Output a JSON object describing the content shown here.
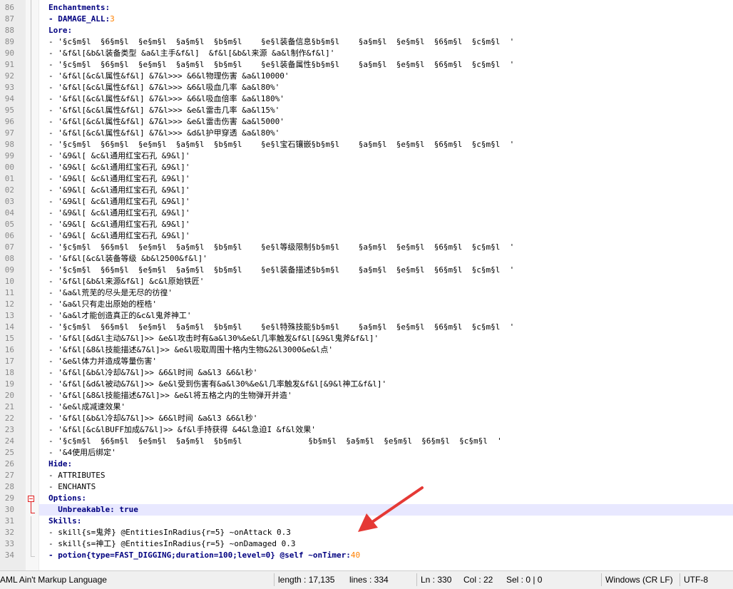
{
  "editor": {
    "lines": [
      {
        "n": "86",
        "segs": [
          [
            "k",
            "Enchantments:"
          ]
        ]
      },
      {
        "n": "87",
        "segs": [
          [
            "k",
            "- DAMAGE_ALL:"
          ],
          [
            "num",
            "3"
          ]
        ]
      },
      {
        "n": "88",
        "segs": [
          [
            "k",
            "Lore:"
          ]
        ]
      },
      {
        "n": "89",
        "segs": [
          [
            "t",
            "- '§c§m§l  §6§m§l  §e§m§l  §a§m§l  §b§m§l    §e§l装备信息§b§m§l    §a§m§l  §e§m§l  §6§m§l  §c§m§l  '"
          ]
        ]
      },
      {
        "n": "90",
        "segs": [
          [
            "t",
            "- '&f&l[&b&l装备类型 &a&l主手&f&l]  &f&l[&b&l来源 &a&l制作&f&l]'"
          ]
        ]
      },
      {
        "n": "91",
        "segs": [
          [
            "t",
            "- '§c§m§l  §6§m§l  §e§m§l  §a§m§l  §b§m§l    §e§l装备属性§b§m§l    §a§m§l  §e§m§l  §6§m§l  §c§m§l  '"
          ]
        ]
      },
      {
        "n": "92",
        "segs": [
          [
            "t",
            "- '&f&l[&c&l属性&f&l] &7&l>>> &6&l物理伤害 &a&l10000'"
          ]
        ]
      },
      {
        "n": "93",
        "segs": [
          [
            "t",
            "- '&f&l[&c&l属性&f&l] &7&l>>> &6&l吸血几率 &a&l80%'"
          ]
        ]
      },
      {
        "n": "94",
        "segs": [
          [
            "t",
            "- '&f&l[&c&l属性&f&l] &7&l>>> &6&l吸血倍率 &a&l180%'"
          ]
        ]
      },
      {
        "n": "95",
        "segs": [
          [
            "t",
            "- '&f&l[&c&l属性&f&l] &7&l>>> &e&l雷击几率 &a&l15%'"
          ]
        ]
      },
      {
        "n": "96",
        "segs": [
          [
            "t",
            "- '&f&l[&c&l属性&f&l] &7&l>>> &e&l雷击伤害 &a&l5000'"
          ]
        ]
      },
      {
        "n": "97",
        "segs": [
          [
            "t",
            "- '&f&l[&c&l属性&f&l] &7&l>>> &d&l护甲穿透 &a&l80%'"
          ]
        ]
      },
      {
        "n": "98",
        "segs": [
          [
            "t",
            "- '§c§m§l  §6§m§l  §e§m§l  §a§m§l  §b§m§l    §e§l宝石镶嵌§b§m§l    §a§m§l  §e§m§l  §6§m§l  §c§m§l  '"
          ]
        ]
      },
      {
        "n": "99",
        "segs": [
          [
            "t",
            "- '&9&l[ &c&l通用红宝石孔 &9&l]'"
          ]
        ]
      },
      {
        "n": "00",
        "segs": [
          [
            "t",
            "- '&9&l[ &c&l通用红宝石孔 &9&l]'"
          ]
        ]
      },
      {
        "n": "01",
        "segs": [
          [
            "t",
            "- '&9&l[ &c&l通用红宝石孔 &9&l]'"
          ]
        ]
      },
      {
        "n": "02",
        "segs": [
          [
            "t",
            "- '&9&l[ &c&l通用红宝石孔 &9&l]'"
          ]
        ]
      },
      {
        "n": "03",
        "segs": [
          [
            "t",
            "- '&9&l[ &c&l通用红宝石孔 &9&l]'"
          ]
        ]
      },
      {
        "n": "04",
        "segs": [
          [
            "t",
            "- '&9&l[ &c&l通用红宝石孔 &9&l]'"
          ]
        ]
      },
      {
        "n": "05",
        "segs": [
          [
            "t",
            "- '&9&l[ &c&l通用红宝石孔 &9&l]'"
          ]
        ]
      },
      {
        "n": "06",
        "segs": [
          [
            "t",
            "- '&9&l[ &c&l通用红宝石孔 &9&l]'"
          ]
        ]
      },
      {
        "n": "07",
        "segs": [
          [
            "t",
            "- '§c§m§l  §6§m§l  §e§m§l  §a§m§l  §b§m§l    §e§l等级限制§b§m§l    §a§m§l  §e§m§l  §6§m§l  §c§m§l  '"
          ]
        ]
      },
      {
        "n": "08",
        "segs": [
          [
            "t",
            "- '&f&l[&c&l装备等级 &b&l2500&f&l]'"
          ]
        ]
      },
      {
        "n": "09",
        "segs": [
          [
            "t",
            "- '§c§m§l  §6§m§l  §e§m§l  §a§m§l  §b§m§l    §e§l装备描述§b§m§l    §a§m§l  §e§m§l  §6§m§l  §c§m§l  '"
          ]
        ]
      },
      {
        "n": "10",
        "segs": [
          [
            "t",
            "- '&f&l[&b&l来源&f&l] &c&l原始铁匠'"
          ]
        ]
      },
      {
        "n": "11",
        "segs": [
          [
            "t",
            "- '&a&l荒芜的尽头是无尽的彷徨'"
          ]
        ]
      },
      {
        "n": "12",
        "segs": [
          [
            "t",
            "- '&a&l只有走出原始的桎梏'"
          ]
        ]
      },
      {
        "n": "13",
        "segs": [
          [
            "t",
            "- '&a&l才能创造真正的&c&l鬼斧神工'"
          ]
        ]
      },
      {
        "n": "14",
        "segs": [
          [
            "t",
            "- '§c§m§l  §6§m§l  §e§m§l  §a§m§l  §b§m§l    §e§l特殊技能§b§m§l    §a§m§l  §e§m§l  §6§m§l  §c§m§l  '"
          ]
        ]
      },
      {
        "n": "15",
        "segs": [
          [
            "t",
            "- '&f&l[&d&l主动&7&l]>> &e&l攻击时有&a&l30%&e&l几率触发&f&l[&9&l鬼斧&f&l]'"
          ]
        ]
      },
      {
        "n": "16",
        "segs": [
          [
            "t",
            "- '&f&l[&8&l技能描述&7&l]>> &e&l吸取周围十格内生物&2&l3000&e&l点'"
          ]
        ]
      },
      {
        "n": "17",
        "segs": [
          [
            "t",
            "- '&e&l体力并造成等量伤害'"
          ]
        ]
      },
      {
        "n": "18",
        "segs": [
          [
            "t",
            "- '&f&l[&b&l冷却&7&l]>> &6&l时间 &a&l3 &6&l秒'"
          ]
        ]
      },
      {
        "n": "19",
        "segs": [
          [
            "t",
            "- '&f&l[&d&l被动&7&l]>> &e&l受到伤害有&a&l30%&e&l几率触发&f&l[&9&l神工&f&l]'"
          ]
        ]
      },
      {
        "n": "20",
        "segs": [
          [
            "t",
            "- '&f&l[&8&l技能描述&7&l]>> &e&l将五格之内的生物弹开并造'"
          ]
        ]
      },
      {
        "n": "21",
        "segs": [
          [
            "t",
            "- '&e&l成减速效果'"
          ]
        ]
      },
      {
        "n": "22",
        "segs": [
          [
            "t",
            "- '&f&l[&b&l冷却&7&l]>> &6&l时间 &a&l3 &6&l秒'"
          ]
        ]
      },
      {
        "n": "23",
        "segs": [
          [
            "t",
            "- '&f&l[&c&lBUFF加成&7&l]>> &f&l手持获得 &4&l急迫I &f&l效果'"
          ]
        ]
      },
      {
        "n": "24",
        "segs": [
          [
            "t",
            "- '§c§m§l  §6§m§l  §e§m§l  §a§m§l  §b§m§l              §b§m§l  §a§m§l  §e§m§l  §6§m§l  §c§m§l  '"
          ]
        ]
      },
      {
        "n": "25",
        "segs": [
          [
            "t",
            "- '&4使用后绑定'"
          ]
        ]
      },
      {
        "n": "26",
        "segs": [
          [
            "k",
            "Hide:"
          ]
        ]
      },
      {
        "n": "27",
        "segs": [
          [
            "t",
            "- ATTRIBUTES"
          ]
        ]
      },
      {
        "n": "28",
        "segs": [
          [
            "t",
            "- ENCHANTS"
          ]
        ]
      },
      {
        "n": "29",
        "segs": [
          [
            "k",
            "Options:"
          ]
        ]
      },
      {
        "n": "30",
        "segs": [
          [
            "k",
            "  Unbreakable: "
          ],
          [
            "val",
            "true"
          ]
        ]
      },
      {
        "n": "31",
        "segs": [
          [
            "k",
            "Skills:"
          ]
        ]
      },
      {
        "n": "32",
        "segs": [
          [
            "t",
            "- skill{s=鬼斧} @EntitiesInRadius{r=5} ~onAttack 0.3"
          ]
        ]
      },
      {
        "n": "33",
        "segs": [
          [
            "t",
            "- skill{s=神工} @EntitiesInRadius{r=5} ~onDamaged 0.3"
          ]
        ]
      },
      {
        "n": "34",
        "segs": [
          [
            "k",
            "- potion{type=FAST_DIGGING;duration=100;level=0} @self ~onTimer:"
          ],
          [
            "num",
            "40"
          ]
        ]
      }
    ]
  },
  "statusbar": {
    "language": "AML Ain't Markup Language",
    "length": "length : 17,135",
    "lines": "lines : 334",
    "ln": "Ln : 330",
    "col": "Col : 22",
    "sel": "Sel : 0 | 0",
    "eol": "Windows (CR LF)",
    "encoding": "UTF-8"
  },
  "colors": {
    "keyword": "#000080",
    "number": "#ff8000",
    "current_line": "#e8e8ff",
    "fold_marker": "#e02020",
    "annotation_arrow": "#e53935"
  },
  "icons": [
    "fold-marker-icon",
    "annotation-arrow"
  ]
}
